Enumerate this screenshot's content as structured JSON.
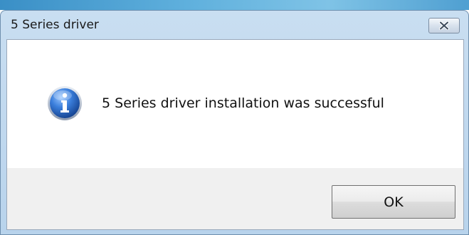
{
  "dialog": {
    "title": "5 Series driver",
    "message": "5 Series driver installation was successful",
    "ok_label": "OK",
    "icon": "info-icon",
    "close_icon": "close-icon"
  },
  "colors": {
    "titlebar": "#c9def1",
    "button_area": "#f0f0f0",
    "icon_blue": "#1f5fb8"
  }
}
